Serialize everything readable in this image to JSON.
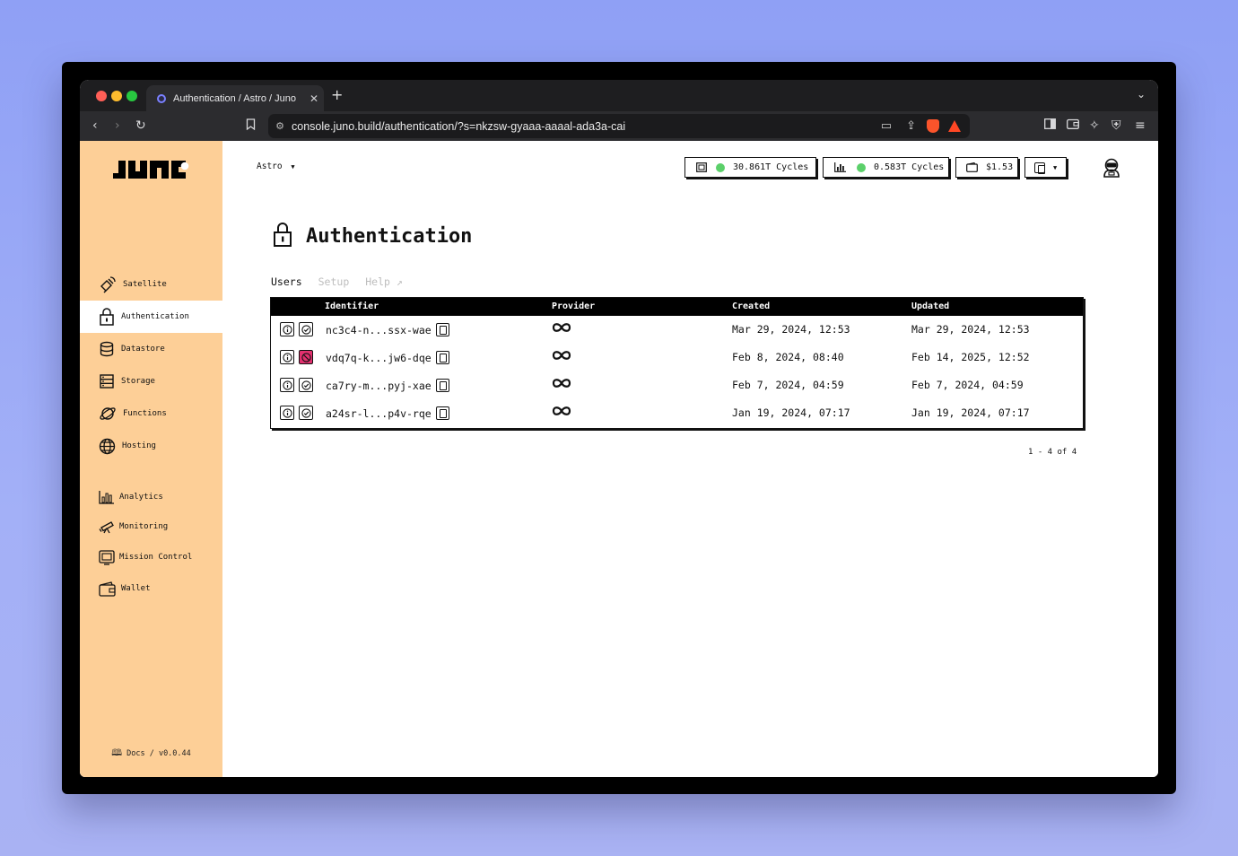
{
  "browser": {
    "tab_title": "Authentication / Astro / Juno",
    "tab_close": "✕",
    "new_tab": "+",
    "url": "console.juno.build/authentication/?s=nkzsw-gyaaa-aaaal-ada3a-cai"
  },
  "sidebar": {
    "logo": "JUNO",
    "items": [
      {
        "label": "Satellite",
        "icon": "satellite-icon"
      },
      {
        "label": "Authentication",
        "icon": "lock-icon",
        "active": true
      },
      {
        "label": "Datastore",
        "icon": "database-icon"
      },
      {
        "label": "Storage",
        "icon": "storage-icon"
      },
      {
        "label": "Functions",
        "icon": "functions-icon"
      },
      {
        "label": "Hosting",
        "icon": "globe-icon"
      },
      {
        "label": "Analytics",
        "icon": "bar-chart-icon"
      },
      {
        "label": "Monitoring",
        "icon": "telescope-icon"
      },
      {
        "label": "Mission Control",
        "icon": "mission-control-icon"
      },
      {
        "label": "Wallet",
        "icon": "wallet-icon"
      }
    ],
    "docs": "Docs / v0.0.44"
  },
  "header": {
    "satellite_name": "Astro",
    "satellite_cycles": "30.861T Cycles",
    "mission_cycles": "0.583T Cycles",
    "wallet_balance": "$1.53",
    "status_color": "#5bd06a"
  },
  "page": {
    "title": "Authentication",
    "tabs": [
      {
        "label": "Users",
        "active": true
      },
      {
        "label": "Setup",
        "active": false
      },
      {
        "label": "Help ↗",
        "active": false
      }
    ]
  },
  "table": {
    "columns": [
      "Identifier",
      "Provider",
      "Created",
      "Updated"
    ],
    "rows": [
      {
        "identifier": "nc3c4-n...ssx-wae",
        "provider": "internet-identity-icon",
        "created": "Mar 29, 2024, 12:53",
        "updated": "Mar 29, 2024, 12:53",
        "banned": false
      },
      {
        "identifier": "vdq7q-k...jw6-dqe",
        "provider": "internet-identity-icon",
        "created": "Feb 8, 2024, 08:40",
        "updated": "Feb 14, 2025, 12:52",
        "banned": true
      },
      {
        "identifier": "ca7ry-m...pyj-xae",
        "provider": "internet-identity-icon",
        "created": "Feb 7, 2024, 04:59",
        "updated": "Feb 7, 2024, 04:59",
        "banned": false
      },
      {
        "identifier": "a24sr-l...p4v-rqe",
        "provider": "internet-identity-icon",
        "created": "Jan 19, 2024, 07:17",
        "updated": "Jan 19, 2024, 07:17",
        "banned": false
      }
    ],
    "pagination": "1 - 4 of 4"
  }
}
